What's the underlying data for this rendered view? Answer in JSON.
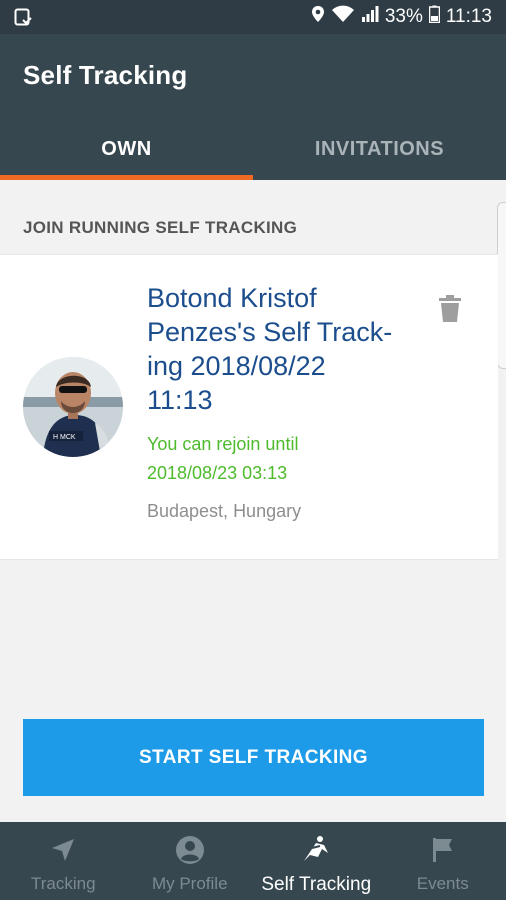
{
  "status_bar": {
    "battery": "33%",
    "time": "11:13",
    "icons": [
      "gallery-icon",
      "location-icon",
      "wifi-icon",
      "signal-icon",
      "battery-icon"
    ]
  },
  "app_bar": {
    "title": "Self Tracking",
    "tabs": [
      {
        "label": "OWN",
        "active": true
      },
      {
        "label": "INVITATIONS",
        "active": false
      }
    ],
    "accent_color": "#f06a24"
  },
  "section": {
    "header": "JOIN RUNNING SELF TRACKING"
  },
  "tracking_card": {
    "title": "Botond Kristof Penzes's Self Track-ing 2018/08/22 11:13",
    "title_lines": [
      "Botond Kristof",
      "Penzes's Self Track-",
      "ing 2018/08/22",
      "11:13"
    ],
    "rejoin_lines": [
      "You can rejoin until",
      "2018/08/23 03:13"
    ],
    "location": "Budapest, Hungary",
    "title_color": "#1c4e8e",
    "rejoin_color": "#4dbb2c"
  },
  "start_button": {
    "label": "START SELF TRACKING",
    "color": "#1e9be8"
  },
  "bottom_nav": {
    "items": [
      {
        "label": "Tracking",
        "icon": "navigation-arrow-icon",
        "active": false
      },
      {
        "label": "My Profile",
        "icon": "profile-icon",
        "active": false
      },
      {
        "label": "Self Tracking",
        "icon": "self-tracking-icon",
        "active": true
      },
      {
        "label": "Events",
        "icon": "flag-icon",
        "active": false
      }
    ]
  }
}
